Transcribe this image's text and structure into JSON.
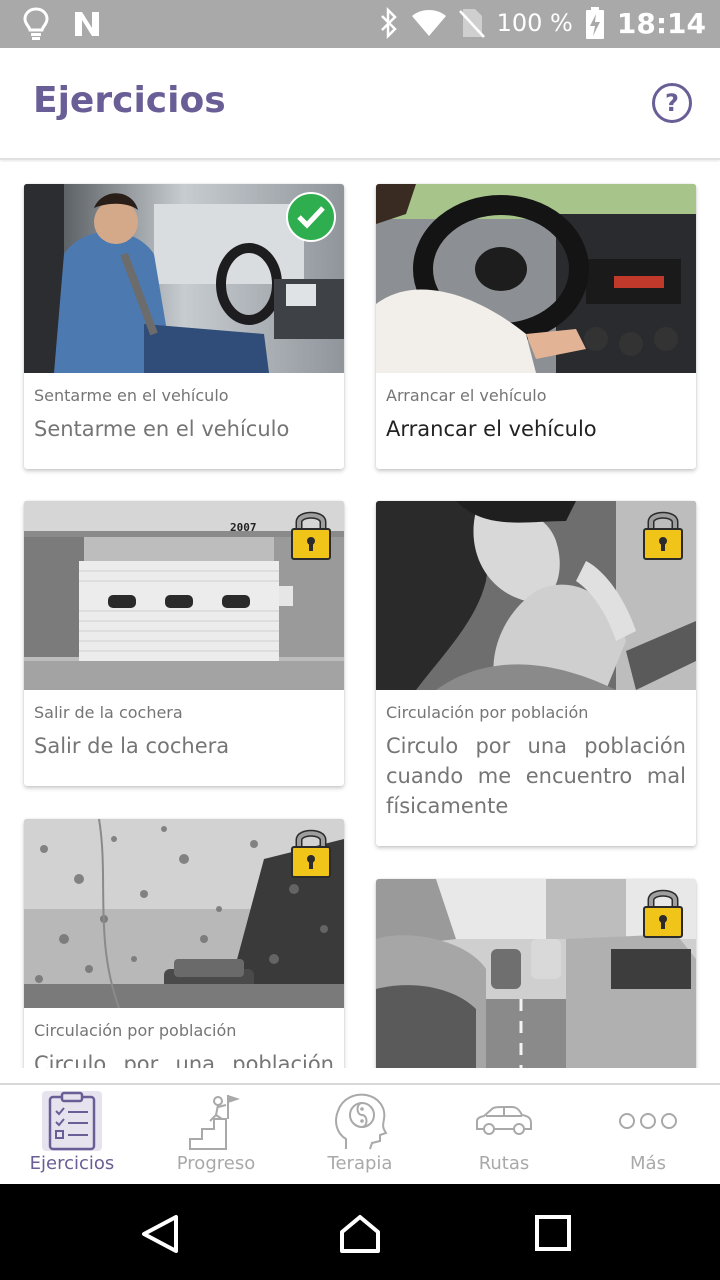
{
  "status_bar": {
    "battery_text": "100 %",
    "time": "18:14",
    "icons": [
      "lightbulb-icon",
      "n-logo-icon",
      "bluetooth-icon",
      "wifi-icon",
      "no-sim-icon",
      "battery-charging-icon"
    ]
  },
  "header": {
    "title": "Ejercicios",
    "help_icon": "help-circle-icon",
    "help_glyph": "?"
  },
  "exercises": [
    {
      "category": "Sentarme en el vehículo",
      "title": "Sentarme en el vehículo",
      "status": "completed",
      "image": "man-fastening-seatbelt"
    },
    {
      "category": "Arrancar el vehículo",
      "title": "Arrancar el vehículo",
      "status": "available",
      "image": "hands-on-steering-wheel"
    },
    {
      "category": "Salir de la cochera",
      "title": "Salir de la cochera",
      "status": "locked",
      "image": "garage-door-2007"
    },
    {
      "category": "Circulación por población",
      "title": "Circulo por una población cuando me encuentro mal físicamente",
      "status": "locked",
      "image": "woman-neck-pain"
    },
    {
      "category": "Circulación por población",
      "title": "Circulo por una población",
      "status": "locked",
      "image": "rain-on-windshield"
    },
    {
      "category": "",
      "title": "",
      "status": "locked",
      "image": "street-traffic"
    }
  ],
  "garage_number": "2007",
  "bottom_nav": [
    {
      "label": "Ejercicios",
      "icon": "clipboard-checklist-icon",
      "active": true
    },
    {
      "label": "Progreso",
      "icon": "climbing-stairs-flag-icon",
      "active": false
    },
    {
      "label": "Terapia",
      "icon": "head-yin-yang-icon",
      "active": false
    },
    {
      "label": "Rutas",
      "icon": "car-icon",
      "active": false
    },
    {
      "label": "Más",
      "icon": "more-dots-icon",
      "active": false
    }
  ],
  "colors": {
    "accent": "#6a5e96",
    "status_bar": "#a9a9a9",
    "check_green": "#2eae4e",
    "lock_gold": "#f0c419",
    "inactive": "#a9a9a9"
  }
}
